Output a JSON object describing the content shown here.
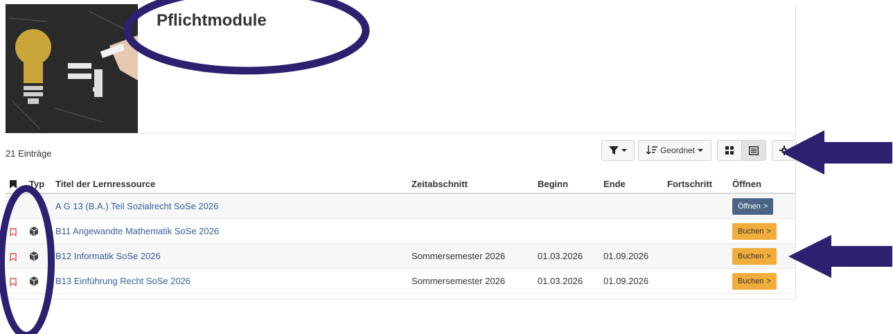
{
  "header": {
    "title": "Pflichtmodule"
  },
  "toolbar": {
    "count": "21 Einträge",
    "filter_icon": "filter-icon",
    "sort_label": "Geordnet",
    "tile_view_icon": "grid-icon",
    "list_view_icon": "list-icon",
    "settings_icon": "gear-icon"
  },
  "table": {
    "columns": [
      "",
      "Typ",
      "Titel der Lernressource",
      "Zeitabschnitt",
      "Beginn",
      "Ende",
      "Fortschritt",
      "Öffnen"
    ],
    "rows": [
      {
        "title": "A G 13 (B.A.) Teil Sozialrecht SoSe 2026",
        "period": "",
        "start": "",
        "end": "",
        "progress": "",
        "action": "Öffnen",
        "action_type": "open"
      },
      {
        "title": "B11 Angewandte Mathematik SoSe 2026",
        "period": "",
        "start": "",
        "end": "",
        "progress": "",
        "action": "Buchen",
        "action_type": "book"
      },
      {
        "title": "B12 Informatik SoSe 2026",
        "period": "Sommersemester 2026",
        "start": "01.03.2026",
        "end": "01.09.2026",
        "progress": "",
        "action": "Buchen",
        "action_type": "book"
      },
      {
        "title": "B13 Einführung Recht SoSe 2026",
        "period": "Sommersemester 2026",
        "start": "01.03.2026",
        "end": "01.09.2026",
        "progress": "",
        "action": "Buchen",
        "action_type": "book"
      }
    ]
  },
  "colors": {
    "link": "#33609a",
    "open_button": "#4c6586",
    "book_button": "#f0ad3c",
    "annotation": "#2b2170",
    "bookmark": "#d9534f"
  }
}
